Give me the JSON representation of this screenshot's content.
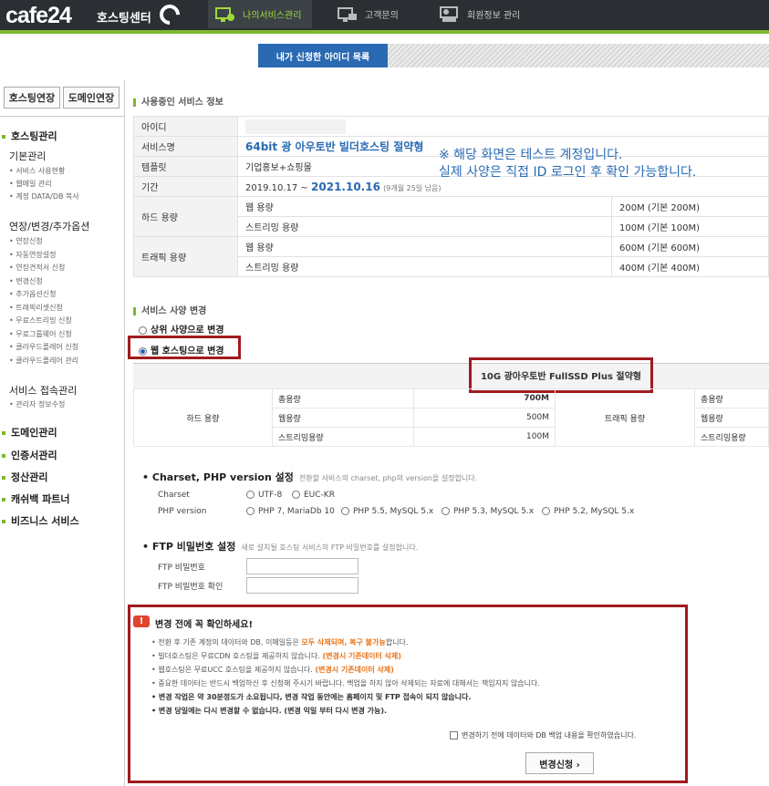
{
  "brand": {
    "logo": "cafe24",
    "subtitle": "호스팅센터"
  },
  "nav": [
    {
      "label": "나의서비스관리",
      "icon": "monitor-gear-icon",
      "active": true
    },
    {
      "label": "고객문의",
      "icon": "monitor-chat-icon",
      "active": false
    },
    {
      "label": "회원정보 관리",
      "icon": "person-monitor-icon",
      "active": false
    }
  ],
  "subtab": {
    "label": "내가 신청한 아이디 목록"
  },
  "sidebar": {
    "buttons": [
      "호스팅연장",
      "도메인연장"
    ],
    "section1_title": "호스팅관리",
    "group1_title": "기본관리",
    "group1_links": [
      "서비스 사용현황",
      "웹메일 관리",
      "계정 DATA/DB 복사"
    ],
    "group2_title": "연장/변경/추가옵션",
    "group2_links": [
      "연장신청",
      "자동연장설정",
      "연장견적서 신청",
      "변경신청",
      "추가옵션신청",
      "트래픽리셋신청",
      "무료스트리밍 신청",
      "무료그룹웨어 신청",
      "클라우드플레어 신청",
      "클라우드플레어 관리"
    ],
    "group3_title": "서비스 접속관리",
    "group3_links": [
      "관리자 정보수정"
    ],
    "sections": [
      "도메인관리",
      "인증서관리",
      "정산관리",
      "캐쉬백 파트너",
      "비즈니스 서비스"
    ]
  },
  "info": {
    "title": "사용중인 서비스 정보",
    "labels": {
      "id": "아이디",
      "service": "서비스명",
      "template": "템플릿",
      "period": "기간",
      "disk": "하드 용량",
      "traffic": "트래픽 용량"
    },
    "service_name": "64bit 광 아우토반 빌더호스팅 절약형",
    "template_value": "기업홍보+쇼핑몰",
    "period_start": "2019.10.17 ~",
    "period_end": "2021.10.16",
    "period_remaining": "(9개월 25일 남음)",
    "web_disk_label": "웹 용량",
    "web_disk_value": "200M (기본 200M)",
    "stream_disk_label": "스트리밍 용량",
    "stream_disk_value": "100M (기본 100M)",
    "web_traffic_label": "웹 용량",
    "web_traffic_value": "600M (기본 600M)",
    "stream_traffic_label": "스트리밍 용량",
    "stream_traffic_value": "400M (기본 400M)"
  },
  "notice": {
    "line1": "※ 해당 화면은 테스트 계정입니다.",
    "line2": "실제 사양은 직접 ID 로그인 후 확인 가능합니다."
  },
  "change": {
    "title": "서비스 사양 변경",
    "option_upper": "상위 사양으로 변경",
    "option_web": "웹 호스팅으로 변경",
    "selected": "웹 호스팅으로 변경"
  },
  "spec": {
    "product": "10G 광아우토반 FullSSD Plus 절약형",
    "disk_label": "하드 용량",
    "traffic_label": "트래픽 용량",
    "rows": [
      {
        "label": "총용량",
        "value": "700M",
        "tlabel": "총용량"
      },
      {
        "label": "웹용량",
        "value": "500M",
        "tlabel": "웹용량"
      },
      {
        "label": "스트리밍용량",
        "value": "100M",
        "tlabel": "스트리밍용량"
      }
    ]
  },
  "charset": {
    "title": "Charset, PHP version 설정",
    "desc": "전환할 서비스의 charset, php의 version을 설정합니다.",
    "charset_label": "Charset",
    "charset_options": [
      "UTF-8",
      "EUC-KR"
    ],
    "php_label": "PHP version",
    "php_options": [
      "PHP 7, MariaDb 10",
      "PHP 5.5, MySQL 5.x",
      "PHP 5.3, MySQL 5.x",
      "PHP 5.2, MySQL 5.x"
    ]
  },
  "ftp": {
    "title": "FTP 비밀번호 설정",
    "desc": "새로 설치될 호스팅 서비스의 FTP 비밀번호를 설정합니다.",
    "pw_label": "FTP 비밀번호",
    "pw_confirm_label": "FTP 비밀번호 확인",
    "pw_value": "",
    "pw_confirm_value": ""
  },
  "warning": {
    "title": "변경 전에 꼭 확인하세요!",
    "l1_a": "전환 후 기존 계정의 데이터와 DB, 이메일등은 ",
    "l1_b": "모두 삭제되며, 복구 불가능",
    "l1_c": "합니다.",
    "l2_a": "빌더호스팅은 무료CDN 호스팅을 제공하지 않습니다. ",
    "l2_b": "(변경시 기존데이터 삭제)",
    "l3_a": "웹호스팅은 무료UCC 호스팅을 제공하지 않습니다. ",
    "l3_b": "(변경시 기존데이터 삭제)",
    "l4": "중요한 데이터는 반드시 백업하신 후 신청해 주시기 바랍니다. 백업을 하지 않아 삭제되는 자료에 대해서는 책임지지 않습니다.",
    "l5": "변경 작업은 약 30분정도가 소요됩니다, 변경 작업 동안에는 홈페이지 및 FTP 접속이 되지 않습니다.",
    "l6": "변경 당일에는 다시 변경할 수 없습니다. (변경 익일 부터 다시 변경 가능).",
    "confirm": "변경하기 전에 데이터와 DB 백업 내용을 확인하였습니다.",
    "apply_button": "변경신청 ›"
  },
  "colors": {
    "accent_green": "#7cb92e",
    "brand_blue": "#2a6ab3",
    "highlight_red": "#a01b1e",
    "warn_orange": "#e8731a"
  }
}
